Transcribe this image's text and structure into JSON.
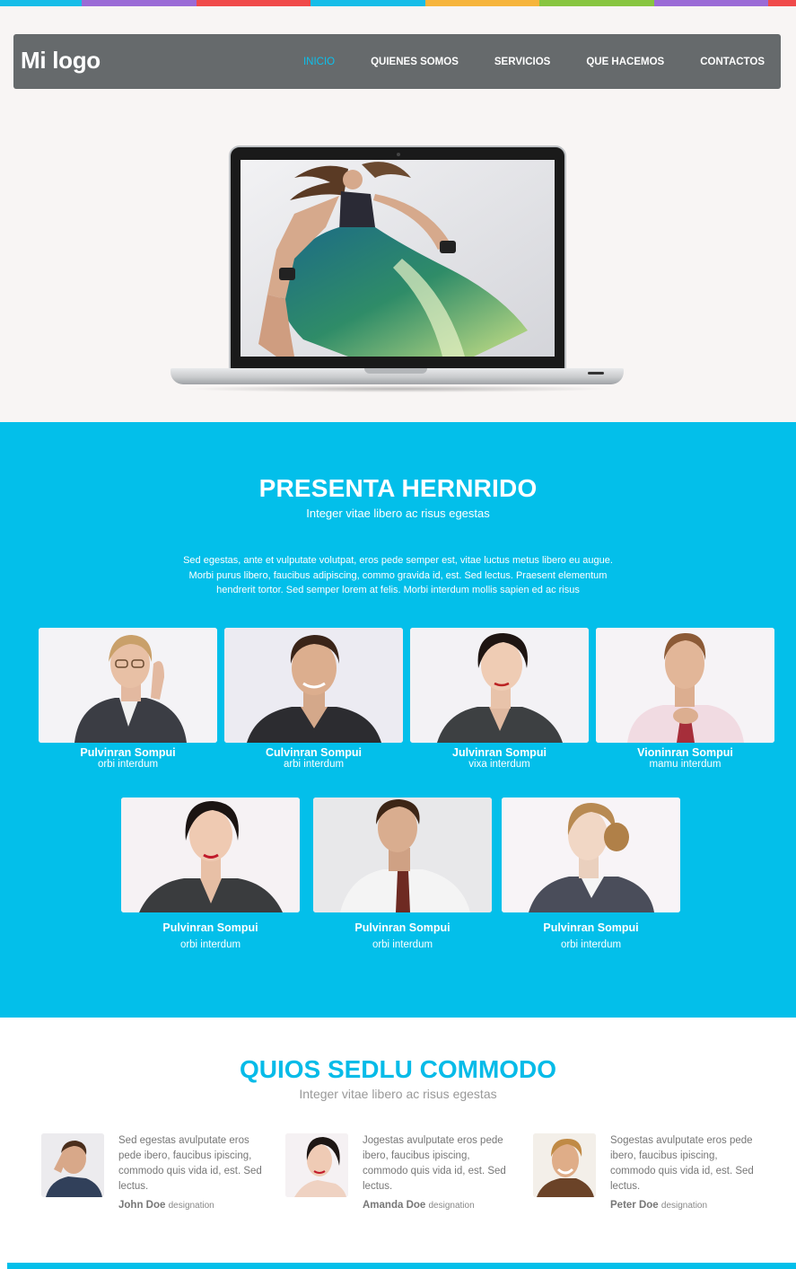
{
  "colors": {
    "accent": "#03bfea",
    "nav_bg": "#666a6c",
    "hero_bg": "#f8f5f4",
    "strip": [
      "#17bde8",
      "#9b6bd6",
      "#f04a4a",
      "#17bde8",
      "#f6b43c",
      "#88c540",
      "#9b6bd6",
      "#f04a4a"
    ]
  },
  "header": {
    "logo": "Mi logo",
    "nav": [
      {
        "label": "INICIO",
        "active": true
      },
      {
        "label": "QUIENES SOMOS"
      },
      {
        "label": "SERVICIOS"
      },
      {
        "label": "QUE HACEMOS"
      },
      {
        "label": "CONTACTOS"
      }
    ]
  },
  "team": {
    "title": "PRESENTA HERNRIDO",
    "subtitle": "Integer vitae libero ac risus egestas",
    "description": "Sed egestas, ante et vulputate volutpat, eros pede semper est, vitae luctus metus libero eu augue. Morbi purus libero, faucibus adipiscing, commo gravida id, est. Sed lectus. Praesent elementum hendrerit tortor. Sed semper lorem at felis. Morbi interdum mollis sapien ed ac risus",
    "members": [
      {
        "name": "Pulvinran Sompui",
        "role": "orbi interdum"
      },
      {
        "name": "Culvinran Sompui",
        "role": "arbi interdum"
      },
      {
        "name": "Julvinran Sompui",
        "role": "vixa interdum"
      },
      {
        "name": "Vioninran Sompui",
        "role": "mamu interdum"
      },
      {
        "name": "Pulvinran Sompui",
        "role": "orbi interdum"
      },
      {
        "name": "Pulvinran Sompui",
        "role": "orbi interdum"
      },
      {
        "name": "Pulvinran Sompui",
        "role": "orbi interdum"
      }
    ]
  },
  "testimonials": {
    "title": "QUIOS SEDLU COMMODO",
    "subtitle": "Integer vitae libero ac risus egestas",
    "items": [
      {
        "text": "Sed egestas avulputate eros pede ibero, faucibus ipiscing, commodo quis vida id, est. Sed lectus.",
        "name": "John Doe",
        "designation": "designation"
      },
      {
        "text": "Jogestas avulputate eros pede ibero, faucibus ipiscing, commodo quis vida id, est. Sed lectus.",
        "name": "Amanda Doe",
        "designation": "designation"
      },
      {
        "text": "Sogestas avulputate eros pede ibero, faucibus ipiscing, commodo quis vida id, est. Sed lectus.",
        "name": "Peter Doe",
        "designation": "designation"
      }
    ]
  }
}
